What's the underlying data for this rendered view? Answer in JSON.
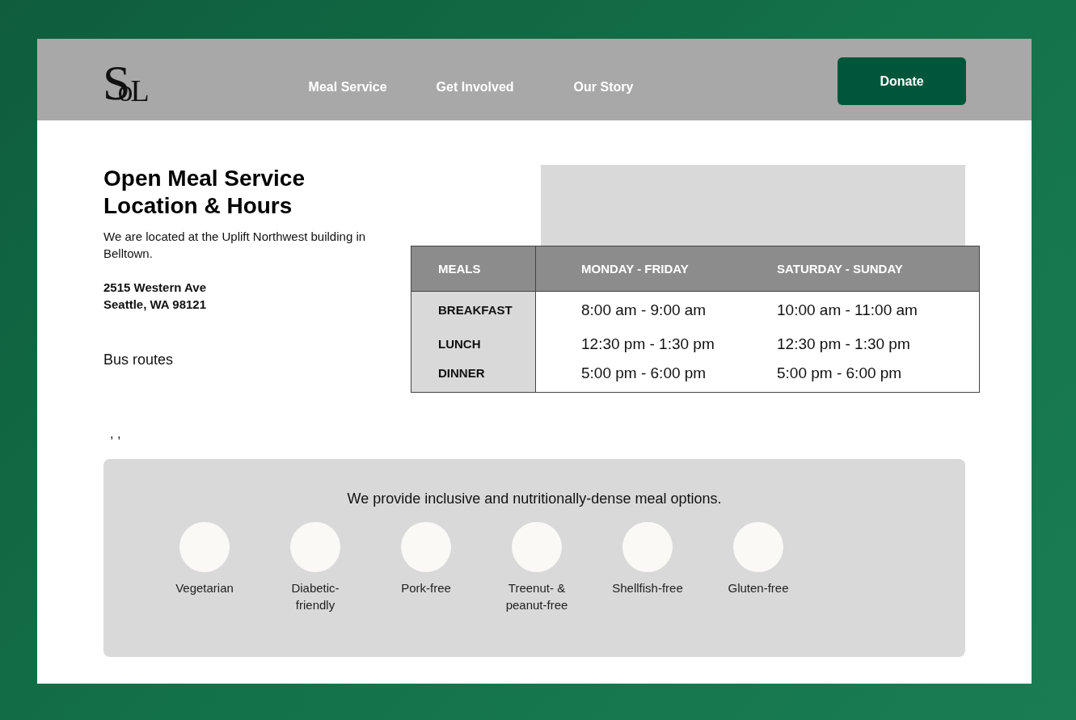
{
  "header": {
    "logo": {
      "large": "S",
      "small": "oL"
    },
    "nav": [
      {
        "label": "Meal Service"
      },
      {
        "label": "Get Involved"
      },
      {
        "label": "Our Story"
      }
    ],
    "donate_button": "Donate"
  },
  "location": {
    "title_lines": [
      "Open Meal Service",
      "Location & Hours"
    ],
    "description": "We are located at the Uplift Northwest building in Belltown.",
    "address_lines": [
      "2515 Western Ave",
      "Seattle, WA 98121"
    ],
    "bus_routes": "Bus routes",
    "stray_text": ", ,"
  },
  "hours_table": {
    "columns": [
      "MEALS",
      "MONDAY - FRIDAY",
      "SATURDAY - SUNDAY"
    ],
    "rows": [
      [
        "BREAKFAST",
        "8:00 am - 9:00 am",
        "10:00 am - 11:00 am"
      ],
      [
        "LUNCH",
        "12:30 pm - 1:30 pm",
        "12:30 pm - 1:30 pm"
      ],
      [
        "DINNER",
        "5:00 pm - 6:00 pm",
        "5:00 pm - 6:00 pm"
      ]
    ]
  },
  "meal_options": {
    "tagline": "We provide inclusive and nutritionally-dense meal options.",
    "options": [
      {
        "label": "Vegetarian"
      },
      {
        "label": "Diabetic-\nfriendly"
      },
      {
        "label": "Pork-free"
      },
      {
        "label": "Treenut- &\npeanut-free"
      },
      {
        "label": "Shellfish-free"
      },
      {
        "label": "Gluten-free"
      }
    ]
  }
}
